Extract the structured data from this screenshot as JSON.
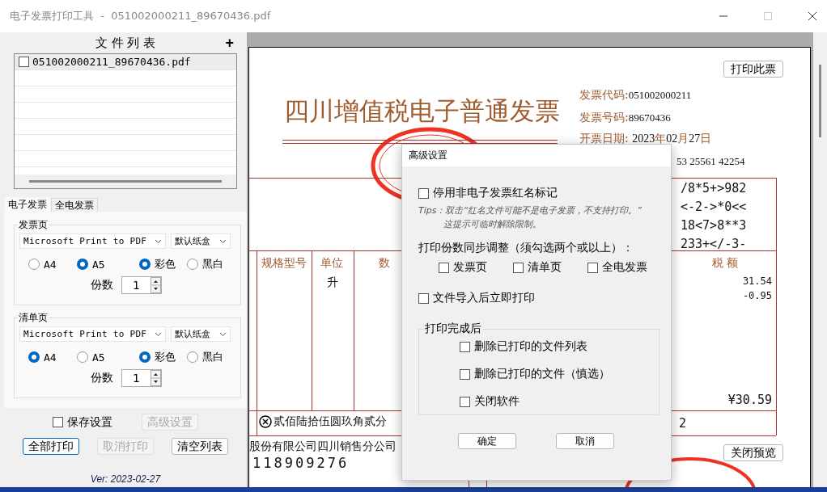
{
  "window": {
    "title": "电子发票打印工具  -  051002000211_89670436.pdf"
  },
  "file_list": {
    "title": "文 件 列 表",
    "add": "+",
    "files": [
      {
        "name": "051002000211_89670436.pdf",
        "checked": false,
        "selected": true
      }
    ]
  },
  "tabs": [
    {
      "label": "电子发票",
      "selected": true
    },
    {
      "label": "全电发票",
      "selected": false
    }
  ],
  "groups": [
    {
      "title": "发票页",
      "printer": "Microsoft Print to PDF",
      "tray": "默认纸盒",
      "sizes": [
        {
          "label": "A4",
          "selected": false
        },
        {
          "label": "A5",
          "selected": true
        }
      ],
      "colors": [
        {
          "label": "彩色",
          "selected": true
        },
        {
          "label": "黑白",
          "selected": false
        }
      ],
      "copies_label": "份数",
      "copies": "1"
    },
    {
      "title": "清单页",
      "printer": "Microsoft Print to PDF",
      "tray": "默认纸盒",
      "sizes": [
        {
          "label": "A4",
          "selected": true
        },
        {
          "label": "A5",
          "selected": false
        }
      ],
      "colors": [
        {
          "label": "彩色",
          "selected": true
        },
        {
          "label": "黑白",
          "selected": false
        }
      ],
      "copies_label": "份数",
      "copies": "1"
    }
  ],
  "save_settings": {
    "label": "保存设置",
    "checked": false
  },
  "advanced_button": {
    "label": "高级设置",
    "disabled": true
  },
  "buttons": [
    {
      "label": "全部打印",
      "disabled": false
    },
    {
      "label": "取消打印",
      "disabled": true
    },
    {
      "label": "清空列表",
      "disabled": false
    }
  ],
  "version": "Ver: 2023-02-27",
  "preview": {
    "print_button": "打印此票",
    "title": "四川增值税电子普通发票",
    "info": [
      {
        "label": "发票代码:",
        "value": "051002000211"
      },
      {
        "label": "发票号码:",
        "value": "89670436"
      }
    ],
    "date": {
      "label": "开票日期:",
      "parts": [
        "2023",
        "年",
        "02",
        "月",
        "27",
        "日"
      ]
    },
    "check_code": "53 25561 42254",
    "cipher": [
      "/8*5+>982",
      "<-2->*0<<",
      "18<7>8**3",
      "233+</-3-"
    ],
    "columns": [
      "规格型号",
      "单位",
      "数",
      "税 额"
    ],
    "unit": "升",
    "taxes": [
      "31.54",
      "-0.95"
    ],
    "total": "¥30.59",
    "amount_words": "贰佰陆拾伍圆玖角贰分",
    "total_fragment": "2",
    "seller": [
      "股份有限公司四川销售分公司",
      "118909276"
    ],
    "close_button": "关闭预览"
  },
  "dialog": {
    "title": "高级设置",
    "disable_red": {
      "label": "停用非电子发票红名标记",
      "checked": false
    },
    "tips": [
      "Tips：双击“红名文件可能不是电子发票，不支持打印。”",
      "这提示可临时解除限制。"
    ],
    "sync_label": "打印份数同步调整（须勾选两个或以上）：",
    "sync_options": [
      {
        "label": "发票页",
        "checked": false
      },
      {
        "label": "清单页",
        "checked": false
      },
      {
        "label": "全电发票",
        "checked": false
      }
    ],
    "print_on_import": {
      "label": "文件导入后立即打印",
      "checked": false
    },
    "after_print": {
      "title": "打印完成后",
      "options": [
        {
          "label": "删除已打印的文件列表",
          "checked": false
        },
        {
          "label": "删除已打印的文件（慎选）",
          "checked": false
        },
        {
          "label": "关闭软件",
          "checked": false
        }
      ]
    },
    "buttons": [
      "确定",
      "取消"
    ]
  }
}
